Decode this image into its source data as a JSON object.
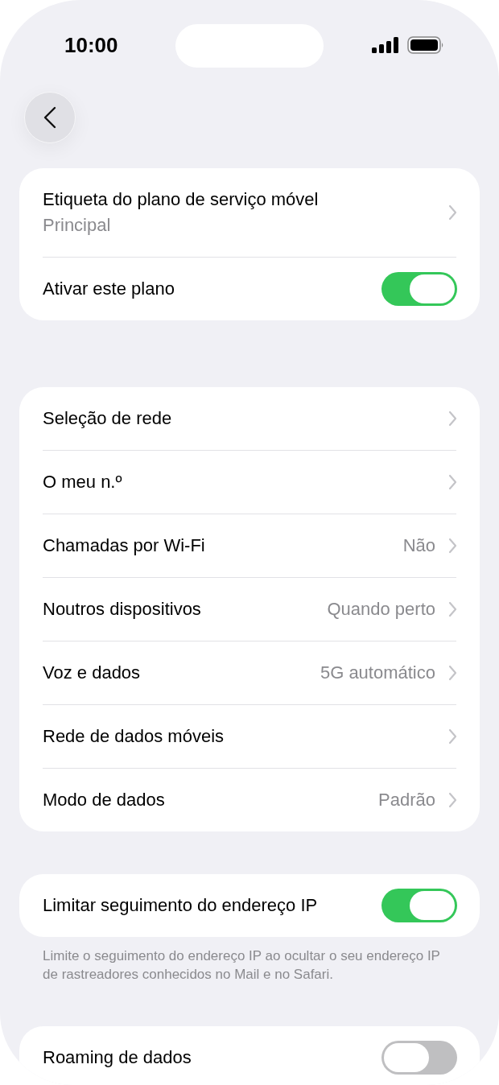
{
  "status_bar": {
    "time": "10:00"
  },
  "groups": [
    {
      "rows": [
        {
          "kind": "nav",
          "label": "Etiqueta do plano de serviço móvel",
          "subtitle": "Principal"
        },
        {
          "kind": "toggle",
          "label": "Ativar este plano",
          "on": true
        }
      ]
    },
    {
      "rows": [
        {
          "kind": "nav",
          "label": "Seleção de rede"
        },
        {
          "kind": "nav",
          "label": "O meu n.º"
        },
        {
          "kind": "nav",
          "label": "Chamadas por Wi-Fi",
          "value": "Não"
        },
        {
          "kind": "nav",
          "label": "Noutros dispositivos",
          "value": "Quando perto"
        },
        {
          "kind": "nav",
          "label": "Voz e dados",
          "value": "5G automático"
        },
        {
          "kind": "nav",
          "label": "Rede de dados móveis"
        },
        {
          "kind": "nav",
          "label": "Modo de dados",
          "value": "Padrão"
        }
      ]
    },
    {
      "rows": [
        {
          "kind": "toggle",
          "label": "Limitar seguimento do endereço IP",
          "on": true
        }
      ],
      "footer": "Limite o seguimento do endereço IP ao ocultar o seu endereço IP de rastreadores conhecidos no Mail e no Safari."
    },
    {
      "rows": [
        {
          "kind": "toggle",
          "label": "Roaming de dados",
          "on": false
        }
      ]
    }
  ]
}
